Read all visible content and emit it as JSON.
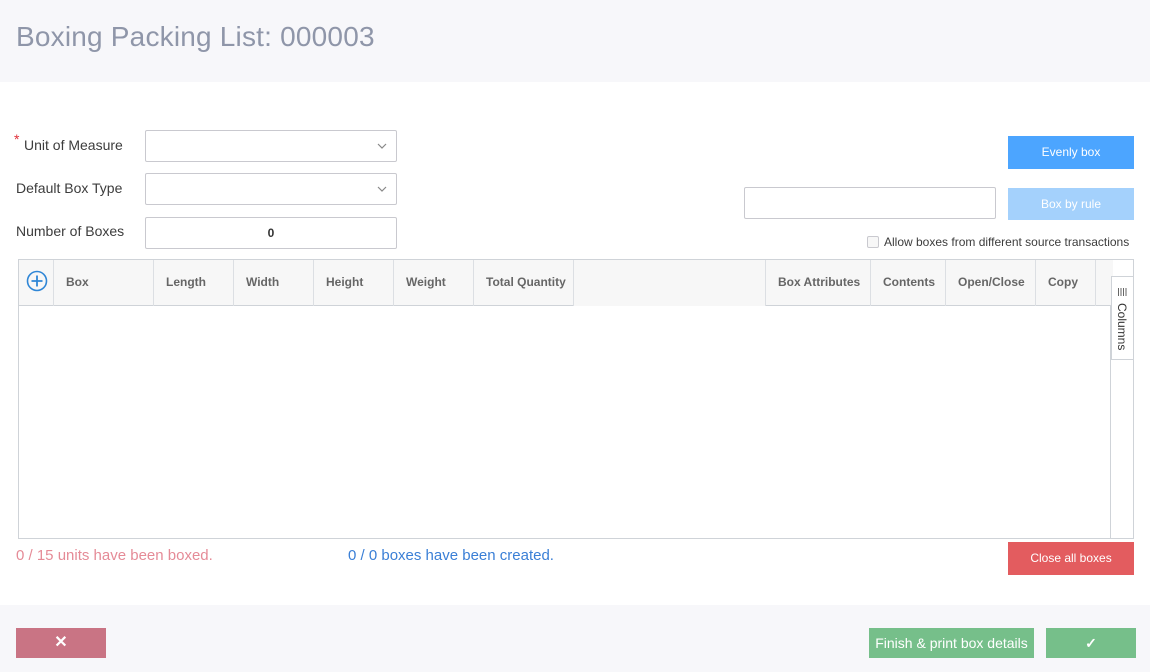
{
  "header": {
    "title": "Boxing Packing List: 000003"
  },
  "form": {
    "required_mark": "*",
    "unit_label": "Unit of Measure",
    "unit_value": "",
    "box_type_label": "Default Box Type",
    "box_type_value": "",
    "num_boxes_label": "Number of Boxes",
    "num_boxes_value": "0"
  },
  "actions": {
    "evenly_box": "Evenly box",
    "box_by_rule": "Box by rule",
    "rule_value": "",
    "allow_label": "Allow boxes from different source transactions"
  },
  "grid": {
    "columns": [
      "Box",
      "Length",
      "Width",
      "Height",
      "Weight",
      "Total Quantity",
      "",
      "Box Attributes",
      "Contents",
      "Open/Close",
      "Copy"
    ],
    "columns_panel": "Columns"
  },
  "status": {
    "units_boxed": "0 / 15 units have been boxed.",
    "boxes_created": "0 / 0 boxes have been created."
  },
  "footer": {
    "close_all": "Close all boxes",
    "cancel_symbol": "✕",
    "finish": "Finish & print box details",
    "confirm_symbol": "✓"
  },
  "colors": {
    "primary": "#4ca5ff",
    "danger": "#e35c5f",
    "success": "#76bf8a",
    "cancel": "#c97484"
  }
}
